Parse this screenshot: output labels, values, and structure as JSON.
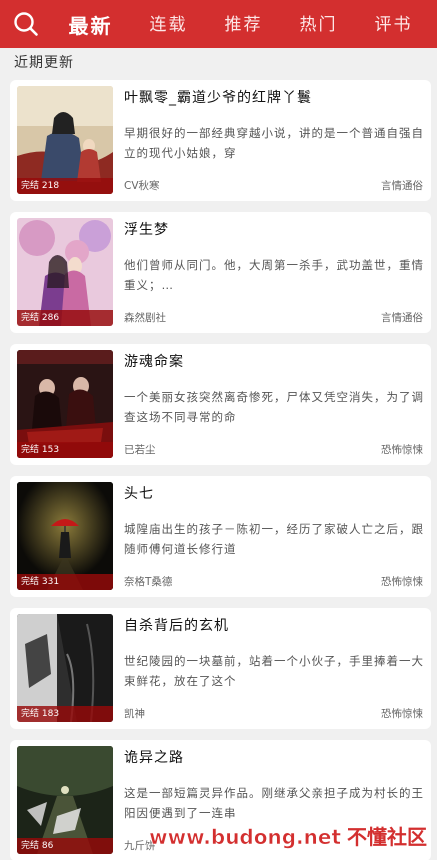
{
  "nav": {
    "tabs": [
      "最新",
      "连载",
      "推荐",
      "热门",
      "评书"
    ],
    "active_index": 0
  },
  "section_title": "近期更新",
  "books": [
    {
      "title": "叶飘零_霸道少爷的红牌丫鬟",
      "desc": "早期很好的一部经典穿越小说，讲的是一个普通自强自立的现代小姑娘，穿",
      "author": "CV秋寒",
      "genre": "言情通俗",
      "tag": "完结 218"
    },
    {
      "title": "浮生梦",
      "desc": "他们曾师从同门。他，大周第一杀手，武功盖世，重情重义；…",
      "author": "森然剧社",
      "genre": "言情通俗",
      "tag": "完结 286"
    },
    {
      "title": "游魂命案",
      "desc": "一个美丽女孩突然离奇惨死，尸体又凭空消失，为了调查这场不同寻常的命",
      "author": "已若尘",
      "genre": "恐怖惊悚",
      "tag": "完结 153"
    },
    {
      "title": "头七",
      "desc": "城隍庙出生的孩子－陈初一，经历了家破人亡之后，跟随师傅何道长修行道",
      "author": "奈格T桑德",
      "genre": "恐怖惊悚",
      "tag": "完结 331"
    },
    {
      "title": "自杀背后的玄机",
      "desc": "世纪陵园的一块墓前，站着一个小伙子，手里捧着一大束鲜花，放在了这个",
      "author": "凯神",
      "genre": "恐怖惊悚",
      "tag": "完结 183"
    },
    {
      "title": "诡异之路",
      "desc": "这是一部短篇灵异作品。刚继承父亲担子成为村长的王阳因便遇到了一连串",
      "author": "九斤饼",
      "genre": "",
      "tag": "完结 86"
    }
  ],
  "watermark": {
    "url": "www.budong.net",
    "name": "不懂社区"
  },
  "colors": {
    "brand": "#d32f2f"
  }
}
